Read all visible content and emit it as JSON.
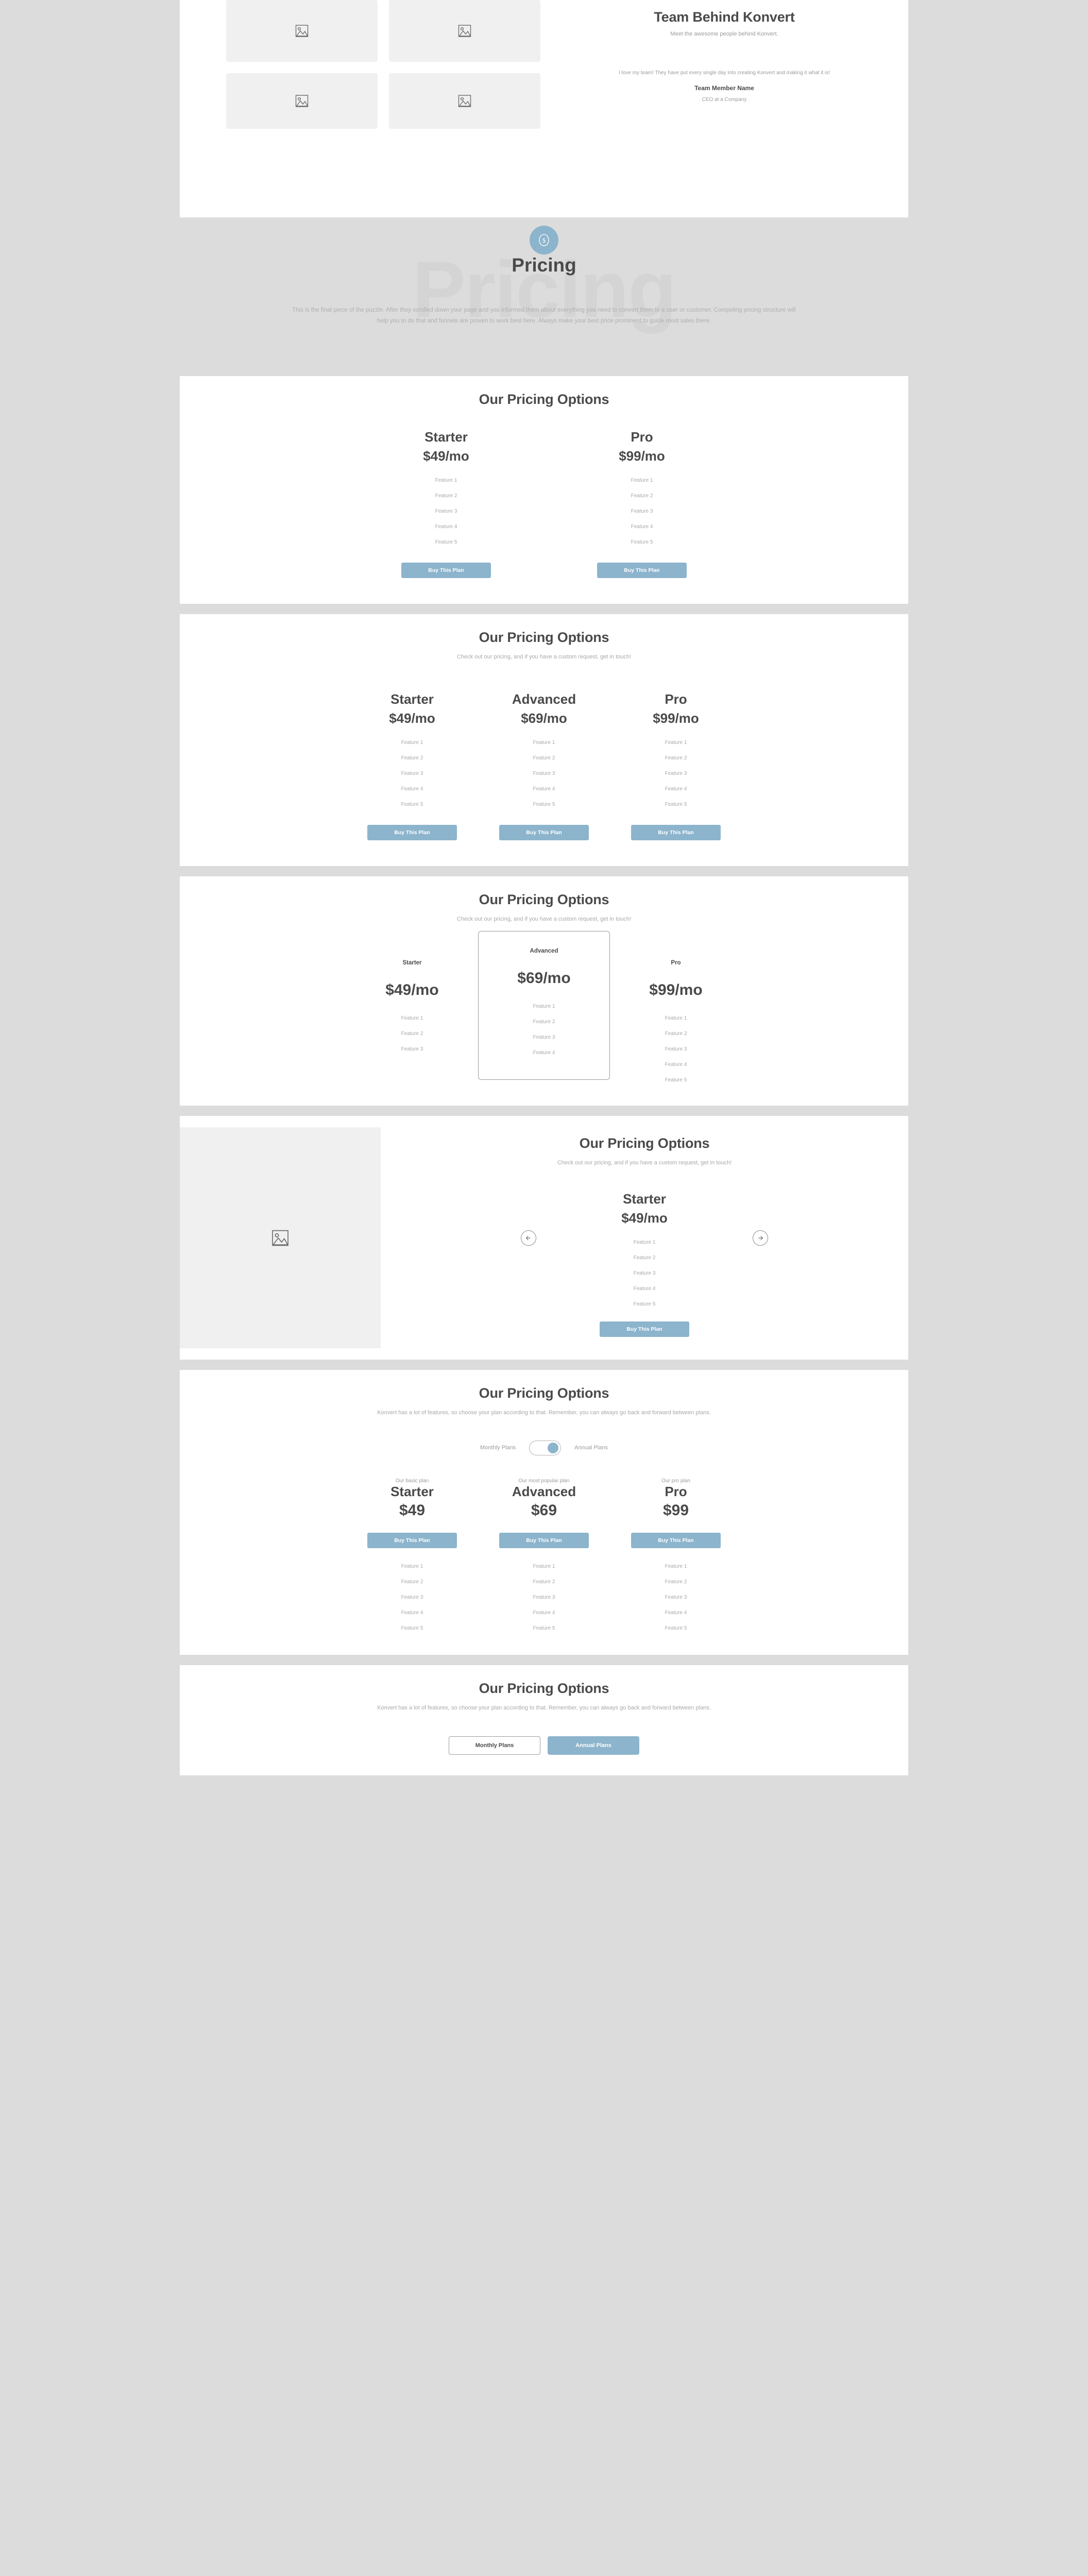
{
  "team": {
    "title": "Team Behind Konvert",
    "subtitle": "Meet the awesome people behind Konvert.",
    "quote": "I love my team! They have put every single day into creating Konvert and making it what it is!",
    "member_name": "Team Member Name",
    "member_role": "CEO at a Company",
    "thumbnails": [
      "image-placeholder",
      "image-placeholder",
      "image-placeholder",
      "image-placeholder"
    ]
  },
  "hero": {
    "ghost_text": "Pricing",
    "badge_icon": "dollar-circle-icon",
    "title": "Pricing",
    "description": "This is the final piece of the puzzle. After they scrolled down your page and you informed them about everything you need to convert them to a user or customer. Compeling pricing structure will help you to do that and funnels are proven to work best here. Always make your best price prominent to guide most sales there."
  },
  "colors": {
    "accent": "#8cb4cc",
    "page_bg": "#dcdcdc",
    "card_bg": "#ffffff",
    "heading": "#4a4a4a",
    "muted": "#a8a8a8",
    "placeholder_bg": "#f0f0f0"
  },
  "buy_label": "Buy This Plan",
  "section1": {
    "title": "Our Pricing Options",
    "plans": [
      {
        "name": "Starter",
        "price": "$49/mo",
        "features": [
          "Feature 1",
          "Feature 2",
          "Feature 3",
          "Feature 4",
          "Feature 5"
        ],
        "cta": "Buy This Plan"
      },
      {
        "name": "Pro",
        "price": "$99/mo",
        "features": [
          "Feature 1",
          "Feature 2",
          "Feature 3",
          "Feature 4",
          "Feature 5"
        ],
        "cta": "Buy This Plan"
      }
    ]
  },
  "section2": {
    "title": "Our Pricing Options",
    "subtitle": "Check out our pricing, and if you have a custom request, get in touch!",
    "plans": [
      {
        "name": "Starter",
        "price": "$49/mo",
        "features": [
          "Feature 1",
          "Feature 2",
          "Feature 3",
          "Feature 4",
          "Feature 5"
        ],
        "cta": "Buy This Plan"
      },
      {
        "name": "Advanced",
        "price": "$69/mo",
        "features": [
          "Feature 1",
          "Feature 2",
          "Feature 3",
          "Feature 4",
          "Feature 5"
        ],
        "cta": "Buy This Plan"
      },
      {
        "name": "Pro",
        "price": "$99/mo",
        "features": [
          "Feature 1",
          "Feature 2",
          "Feature 3",
          "Feature 4",
          "Feature 5"
        ],
        "cta": "Buy This Plan"
      }
    ]
  },
  "section3": {
    "title": "Our Pricing Options",
    "subtitle": "Check out our pricing, and if you have a custom request, get in touch!",
    "plans": [
      {
        "name": "Starter",
        "price": "$49/mo",
        "highlighted": false,
        "features": [
          "Feature 1",
          "Feature 2",
          "Feature 3"
        ]
      },
      {
        "name": "Advanced",
        "price": "$69/mo",
        "highlighted": true,
        "features": [
          "Feature 1",
          "Feature 2",
          "Feature 3",
          "Feature 4"
        ]
      },
      {
        "name": "Pro",
        "price": "$99/mo",
        "highlighted": false,
        "features": [
          "Feature 1",
          "Feature 2",
          "Feature 3",
          "Feature 4",
          "Feature 5"
        ]
      }
    ]
  },
  "section4": {
    "title": "Our Pricing Options",
    "subtitle": "Check out our pricing, and if you have a custom request, get in touch!",
    "image": "image-placeholder",
    "prev_icon": "arrow-left-circle-icon",
    "next_icon": "arrow-right-circle-icon",
    "plan": {
      "name": "Starter",
      "price": "$49/mo",
      "features": [
        "Feature 1",
        "Feature 2",
        "Feature 3",
        "Feature 4",
        "Feature 5"
      ],
      "cta": "Buy This Plan"
    }
  },
  "section5": {
    "title": "Our Pricing Options",
    "subtitle": "Konvert has a lot of features, so choose your plan according to that. Remember, you can always go back and forward between plans.",
    "toggle": {
      "left_label": "Monthly Plans",
      "right_label": "Annual Plans",
      "state": "right"
    },
    "plans": [
      {
        "tag": "Our basic plan",
        "name": "Starter",
        "price": "$49",
        "cta": "Buy This Plan",
        "features": [
          "Feature 1",
          "Feature 2",
          "Feature 3",
          "Feature 4",
          "Feature 5"
        ]
      },
      {
        "tag": "Our most popular plan",
        "name": "Advanced",
        "price": "$69",
        "cta": "Buy This Plan",
        "features": [
          "Feature 1",
          "Feature 2",
          "Feature 3",
          "Feature 4",
          "Feature 5"
        ]
      },
      {
        "tag": "Our pro plan",
        "name": "Pro",
        "price": "$99",
        "cta": "Buy This Plan",
        "features": [
          "Feature 1",
          "Feature 2",
          "Feature 3",
          "Feature 4",
          "Feature 5"
        ]
      }
    ]
  },
  "section6": {
    "title": "Our Pricing Options",
    "subtitle": "Konvert has a lot of features, so choose your plan according to that. Remember, you can always go back and forward between plans.",
    "tabs": [
      {
        "label": "Monthly Plans",
        "active": false
      },
      {
        "label": "Annual Plans",
        "active": true
      }
    ]
  }
}
